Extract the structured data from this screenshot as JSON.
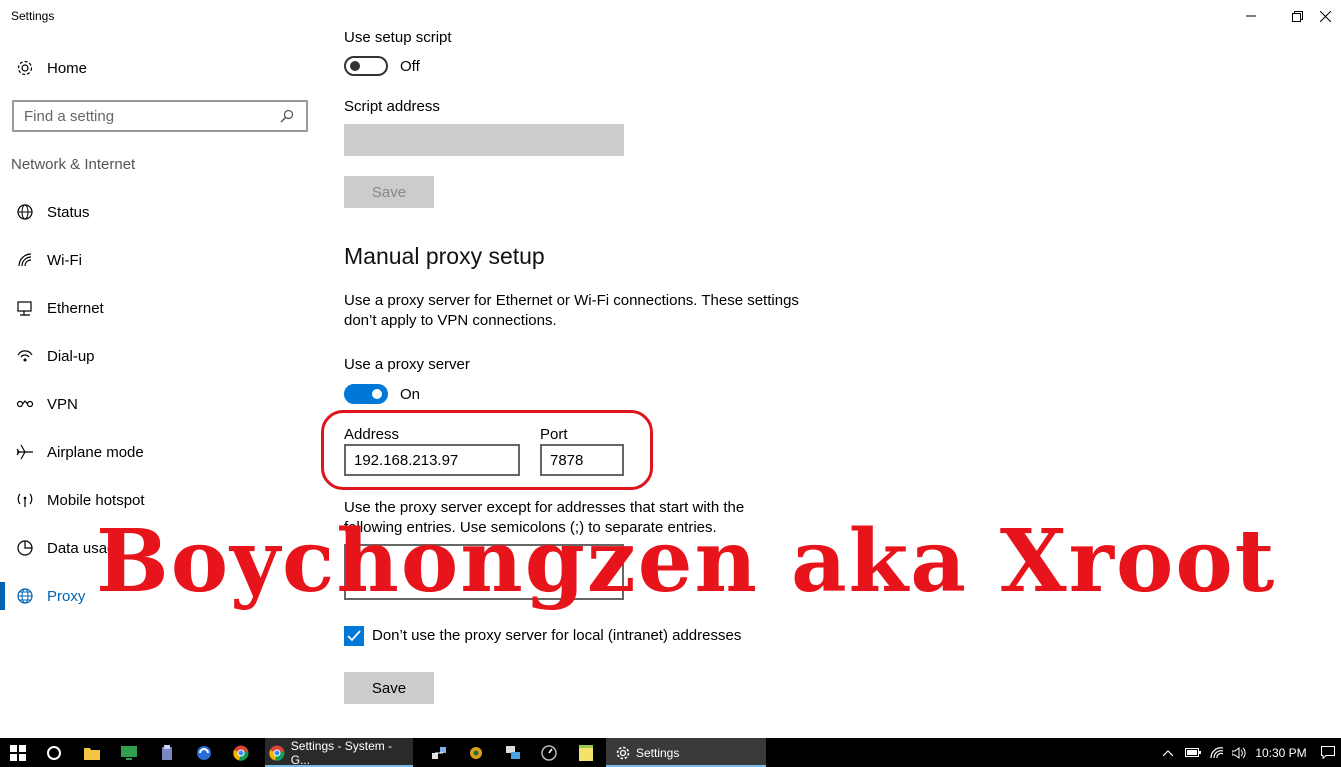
{
  "window": {
    "title": "Settings"
  },
  "sidebar": {
    "home_label": "Home",
    "search_placeholder": "Find a setting",
    "section_label": "Network & Internet",
    "items": [
      {
        "label": "Status",
        "icon": "globe-status-icon"
      },
      {
        "label": "Wi-Fi",
        "icon": "wifi-icon"
      },
      {
        "label": "Ethernet",
        "icon": "ethernet-icon"
      },
      {
        "label": "Dial-up",
        "icon": "dialup-icon"
      },
      {
        "label": "VPN",
        "icon": "vpn-icon"
      },
      {
        "label": "Airplane mode",
        "icon": "airplane-icon"
      },
      {
        "label": "Mobile hotspot",
        "icon": "hotspot-icon"
      },
      {
        "label": "Data usage",
        "icon": "data-usage-icon"
      },
      {
        "label": "Proxy",
        "icon": "globe-icon",
        "active": true
      }
    ]
  },
  "automatic": {
    "script_label": "Use setup script",
    "script_state": "Off",
    "address_label": "Script address",
    "address_value": "",
    "save_label": "Save"
  },
  "manual": {
    "heading": "Manual proxy setup",
    "description_line1": "Use a proxy server for Ethernet or Wi-Fi connections. These settings",
    "description_line2": "don’t apply to VPN connections.",
    "use_proxy_label": "Use a proxy server",
    "use_proxy_state": "On",
    "address_label": "Address",
    "address_value": "192.168.213.97",
    "port_label": "Port",
    "port_value": "7878",
    "exceptions_line1": "Use the proxy server except for addresses that start with the",
    "exceptions_line2": "following entries. Use semicolons (;) to separate entries.",
    "exceptions_value": "",
    "local_checkbox_label": "Don’t use the proxy server for local (intranet) addresses",
    "local_checked": true,
    "save_label": "Save"
  },
  "watermark": "Boychongzen aka Xroot",
  "taskbar": {
    "chrome_window_label": "Settings - System - G...",
    "settings_window_label": "Settings",
    "clock": "10:30 PM"
  },
  "colors": {
    "accent": "#0078d7",
    "active_text": "#0063b1",
    "watermark": "#e8141c",
    "highlight_ring": "#e0141e"
  }
}
